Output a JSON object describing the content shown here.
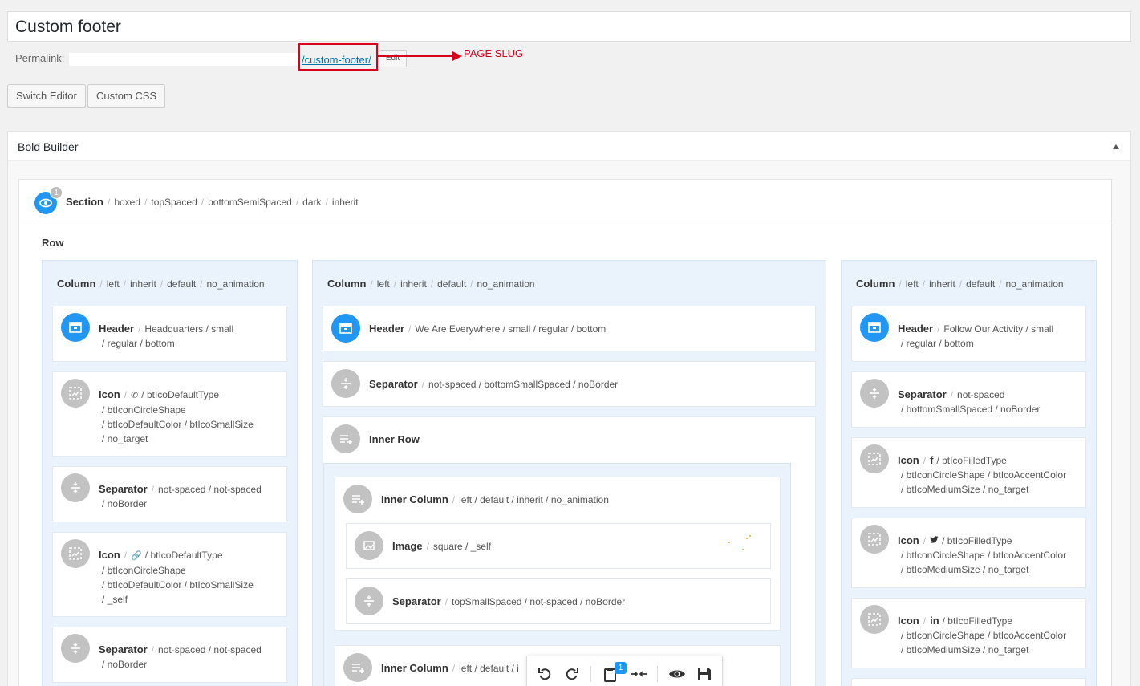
{
  "post_title": "Custom footer",
  "permalink": {
    "label": "Permalink:",
    "slug": "/custom-footer/",
    "edit_label": "Edit"
  },
  "annotation": {
    "text": "PAGE SLUG",
    "color": "#d9001b"
  },
  "buttons": {
    "switch_editor": "Switch Editor",
    "custom_css": "Custom CSS"
  },
  "builder": {
    "title": "Bold Builder",
    "accent": "#2196f3",
    "section": {
      "label": "Section",
      "count": "1",
      "attrs": [
        "boxed",
        "topSpaced",
        "bottomSemiSpaced",
        "dark",
        "inherit"
      ]
    },
    "row_label": "Row",
    "columns": [
      {
        "label": "Column",
        "attrs": [
          "left",
          "inherit",
          "default",
          "no_animation"
        ],
        "elements": [
          {
            "type": "Header",
            "line1": "Headquarters / small",
            "line2": "/ regular / bottom"
          },
          {
            "type": "Icon",
            "line1": "/ btIcoDefaultType",
            "line2": "/ btIconCircleShape",
            "line3": "/ btIcoDefaultColor / btIcoSmallSize",
            "line4": "/ no_target"
          },
          {
            "type": "Separator",
            "line1": "not-spaced / not-spaced",
            "line2": "/ noBorder"
          },
          {
            "type": "Icon",
            "line1": "/ btIcoDefaultType",
            "line2": "/ btIconCircleShape",
            "line3": "/ btIcoDefaultColor / btIcoSmallSize",
            "line4": "/ _self"
          },
          {
            "type": "Separator",
            "line1": "not-spaced / not-spaced",
            "line2": "/ noBorder"
          }
        ]
      },
      {
        "label": "Column",
        "attrs": [
          "left",
          "inherit",
          "default",
          "no_animation"
        ],
        "elements": [
          {
            "type": "Header",
            "line1": "We Are Everywhere / small / regular / bottom"
          },
          {
            "type": "Separator",
            "line1": "not-spaced / bottomSmallSpaced / noBorder"
          },
          {
            "type": "Inner Row"
          }
        ],
        "inner_columns": [
          {
            "label": "Inner Column",
            "attrs": "left / default / inherit / no_animation",
            "elements": [
              {
                "type": "Image",
                "line1": "square / _self"
              },
              {
                "type": "Separator",
                "line1": "topSmallSpaced / not-spaced / noBorder"
              }
            ]
          },
          {
            "label": "Inner Column",
            "attrs": "left / default / i"
          }
        ]
      },
      {
        "label": "Column",
        "attrs": [
          "left",
          "inherit",
          "default",
          "no_animation"
        ],
        "elements": [
          {
            "type": "Header",
            "line1": "Follow Our Activity / small",
            "line2": "/ regular / bottom"
          },
          {
            "type": "Separator",
            "line1": "not-spaced",
            "line2": "/ bottomSmallSpaced / noBorder"
          },
          {
            "type": "Icon",
            "glyph": "f",
            "line1": "/ btIcoFilledType",
            "line2": "/ btIconCircleShape / btIcoAccentColor",
            "line3": "/ btIcoMediumSize / no_target"
          },
          {
            "type": "Icon",
            "glyph": "twitter-bird",
            "line1": "/ btIcoFilledType",
            "line2": "/ btIconCircleShape / btIcoAccentColor",
            "line3": "/ btIcoMediumSize / no_target"
          },
          {
            "type": "Icon",
            "glyph": "in",
            "line1": "/ btIcoFilledType",
            "line2": "/ btIconCircleShape / btIcoAccentColor",
            "line3": "/ btIcoMediumSize / no_target"
          }
        ]
      }
    ],
    "toolbar": {
      "clipboard_count": "1",
      "icons": [
        "undo-icon",
        "redo-icon",
        "clipboard-icon",
        "paste-arrows-icon",
        "preview-eye-icon",
        "save-icon"
      ]
    }
  }
}
